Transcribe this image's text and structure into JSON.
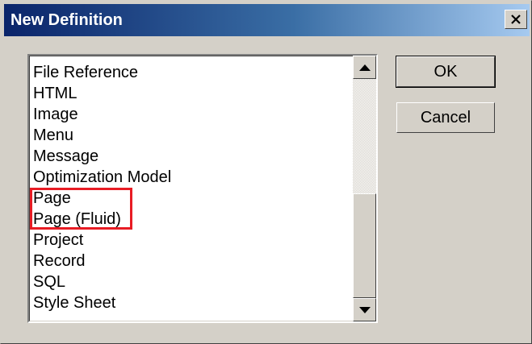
{
  "dialog": {
    "title": "New Definition",
    "close_label": "close"
  },
  "list": {
    "items": [
      {
        "label": "File Reference"
      },
      {
        "label": "HTML"
      },
      {
        "label": "Image"
      },
      {
        "label": "Menu"
      },
      {
        "label": "Message"
      },
      {
        "label": "Optimization Model"
      },
      {
        "label": "Page"
      },
      {
        "label": "Page (Fluid)"
      },
      {
        "label": "Project"
      },
      {
        "label": "Record"
      },
      {
        "label": "SQL"
      },
      {
        "label": "Style Sheet"
      }
    ],
    "highlighted_items": [
      "Page",
      "Page (Fluid)"
    ],
    "highlight_color": "#e81c24"
  },
  "buttons": {
    "ok_label": "OK",
    "cancel_label": "Cancel"
  },
  "icons": {
    "close": "close-x-icon",
    "scroll_up": "triangle-up-icon",
    "scroll_down": "triangle-down-icon"
  },
  "colors": {
    "titlebar_start": "#0a246a",
    "titlebar_end": "#a6caf0",
    "face": "#d4d0c8"
  }
}
